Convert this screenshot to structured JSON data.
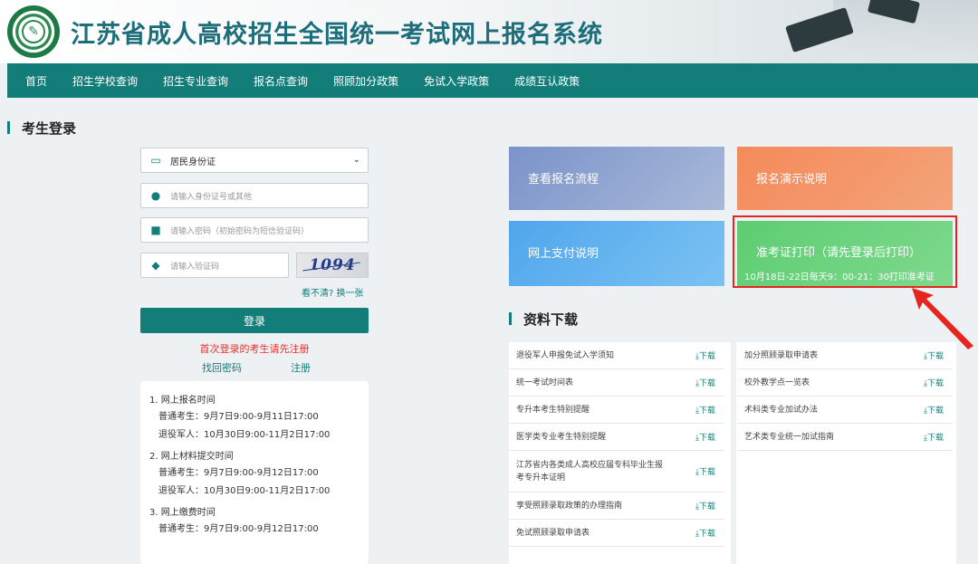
{
  "header": {
    "title": "江苏省成人高校招生全国统一考试网上报名系统"
  },
  "nav": {
    "items": [
      "首页",
      "招生学校查询",
      "招生专业查询",
      "报名点查询",
      "照顾加分政策",
      "免试入学政策",
      "成绩互认政策"
    ]
  },
  "login": {
    "section_title": "考生登录",
    "id_type": "居民身份证",
    "id_placeholder": "请输入身份证号或其他",
    "password_placeholder": "请输入密码（初始密码为短信验证码）",
    "captcha_placeholder": "请输入验证码",
    "captcha_text": "1094",
    "refresh_link": "看不清? 换一张",
    "submit_label": "登录",
    "first_login_notice": "首次登录的考生请先注册",
    "find_password": "找回密码",
    "register": "注册"
  },
  "notice": {
    "items": [
      {
        "title": "1. 网上报名时间",
        "lines": [
          "普通考生：9月7日9:00-9月11日17:00",
          "退役军人：10月30日9:00-11月2日17:00"
        ]
      },
      {
        "title": "2. 网上材料提交时间",
        "lines": [
          "普通考生：9月7日9:00-9月12日17:00",
          "退役军人：10月30日9:00-11月2日17:00"
        ]
      },
      {
        "title": "3. 网上缴费时间",
        "lines": [
          "普通考生：9月7日9:00-9月12日17:00"
        ]
      }
    ]
  },
  "tiles": {
    "flow": "查看报名流程",
    "demo": "报名演示说明",
    "pay": "网上支付说明",
    "print": "准考证打印（请先登录后打印）",
    "print_sub": "10月18日-22日每天9：00-21：30打印准考证"
  },
  "downloads": {
    "section_title": "资料下载",
    "link_label": "下载",
    "left": [
      "退役军人申报免试入学须知",
      "统一考试时间表",
      "专升本考生特别提醒",
      "医学类专业考生特别提醒",
      "江苏省内各类成人高校应届专科毕业生报考专升本证明",
      "享受照顾录取政策的办理指南",
      "免试照顾录取申请表"
    ],
    "right": [
      "加分照顾录取申请表",
      "校外教学点一览表",
      "术科类专业加试办法",
      "艺术类专业统一加试指南"
    ]
  },
  "colors": {
    "primary": "#137d7a",
    "alert": "#e8322c",
    "tile_flow": "#8aa1cf",
    "tile_demo": "#f4926a",
    "tile_pay": "#5fb1ee",
    "tile_print": "#68d27c"
  }
}
